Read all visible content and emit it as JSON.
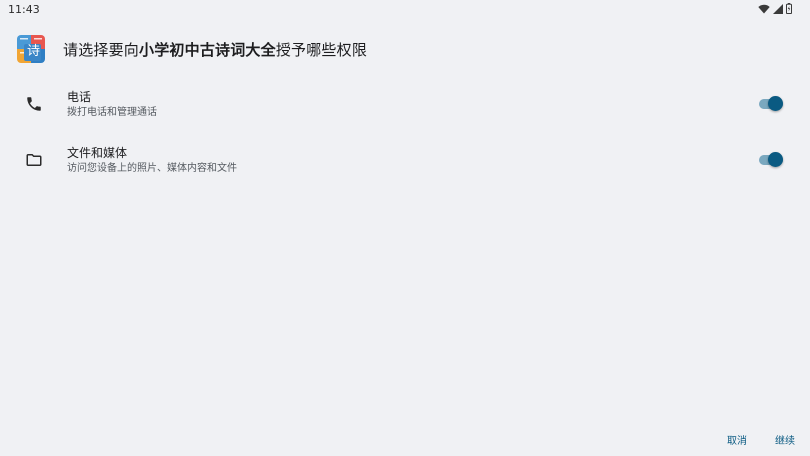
{
  "status_bar": {
    "time": "11:43",
    "icons": [
      "wifi-icon",
      "cell-signal-icon",
      "battery-icon"
    ]
  },
  "header": {
    "app_icon": "shici-app-icon",
    "app_icon_char": "诗",
    "title_prefix": "请选择要向",
    "app_name": "小学初中古诗词大全",
    "title_suffix": "授予哪些权限"
  },
  "permissions": [
    {
      "icon": "phone-icon",
      "title": "电话",
      "description": "拨打电话和管理通话",
      "enabled": true
    },
    {
      "icon": "folder-icon",
      "title": "文件和媒体",
      "description": "访问您设备上的照片、媒体内容和文件",
      "enabled": true
    }
  ],
  "footer": {
    "cancel_label": "取消",
    "continue_label": "继续"
  },
  "colors": {
    "background": "#f0f1f4",
    "accent": "#0a5a82",
    "toggle_track": "#7aa8bf"
  }
}
